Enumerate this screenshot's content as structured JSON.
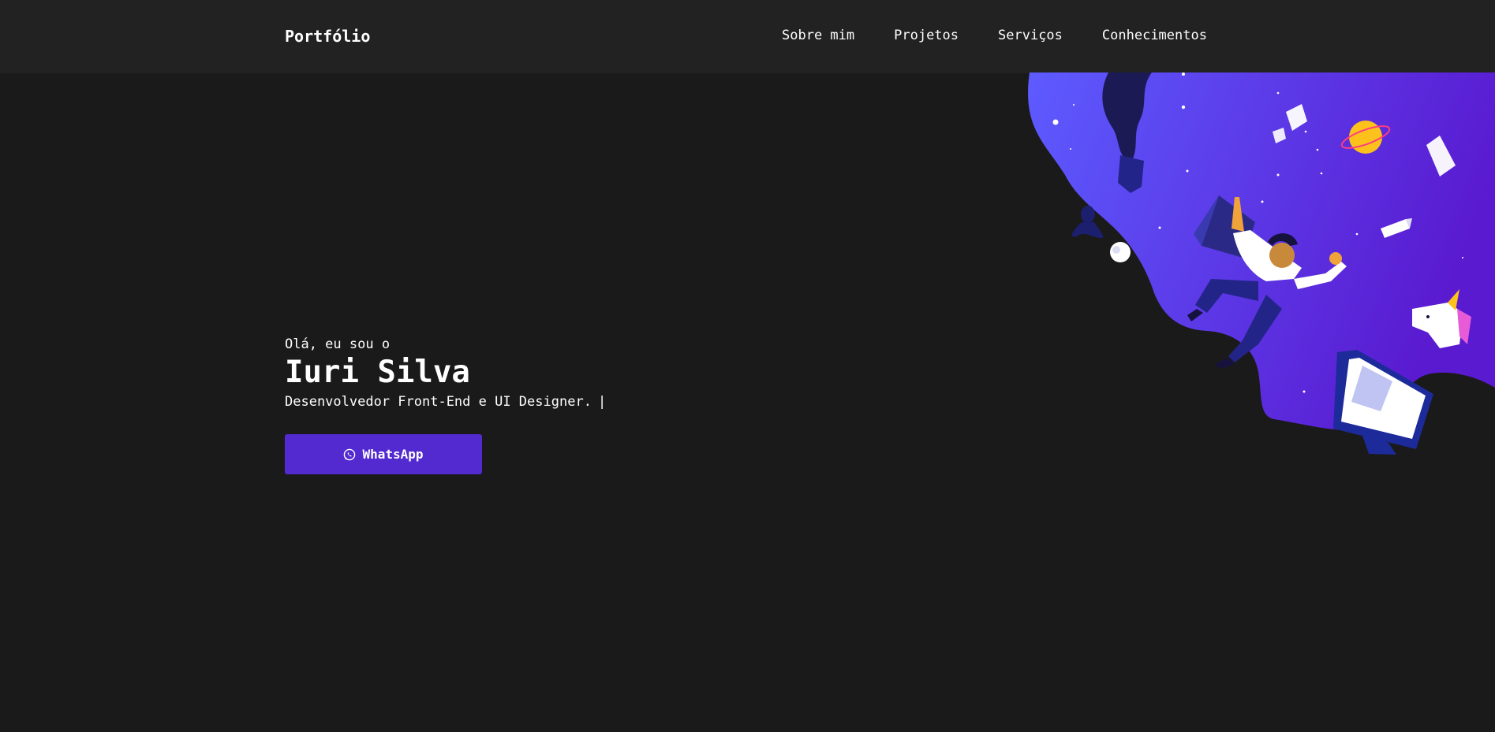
{
  "navbar": {
    "brand": "Portfólio",
    "links": [
      "Sobre mim",
      "Projetos",
      "Serviços",
      "Conhecimentos"
    ]
  },
  "hero": {
    "greeting": "Olá, eu sou o",
    "name": "Iuri Silva",
    "tagline": "Desenvolvedor Front-End e UI Designer.",
    "cursor": "|",
    "cta_label": "WhatsApp"
  },
  "colors": {
    "background": "#1a1a1a",
    "navbar": "#222222",
    "accent": "#5329d0",
    "blob_start": "#5d5bff",
    "blob_end": "#5a1ad0"
  },
  "icons": {
    "cta_icon": "whatsapp-icon"
  }
}
